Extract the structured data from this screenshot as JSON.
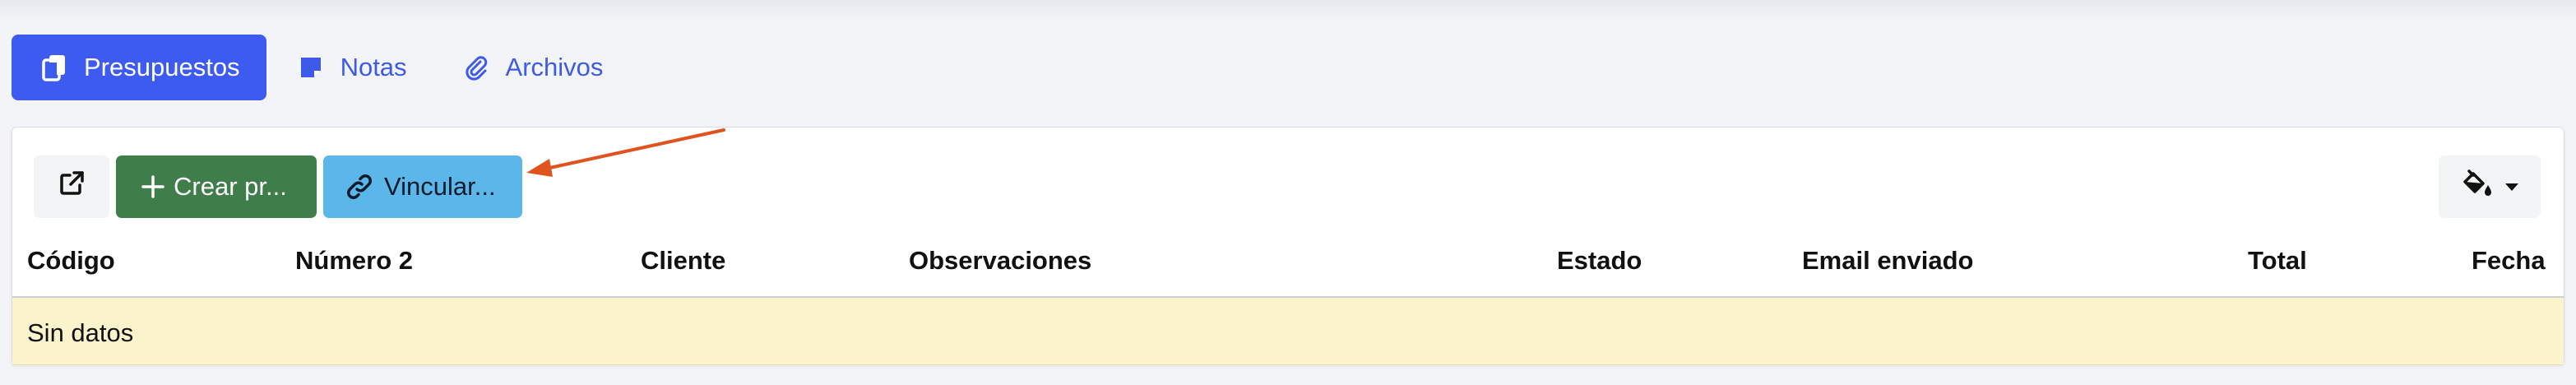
{
  "tabs": [
    {
      "label": "Presupuestos",
      "icon": "copy-icon",
      "active": true
    },
    {
      "label": "Notas",
      "icon": "sticky-note-icon",
      "active": false
    },
    {
      "label": "Archivos",
      "icon": "paperclip-icon",
      "active": false
    }
  ],
  "toolbar": {
    "open_external_icon": "external-link-icon",
    "create_label": "Crear pr...",
    "create_icon": "plus-icon",
    "link_label": "Vincular...",
    "link_icon": "link-icon",
    "paint_icon": "paint-bucket-icon",
    "paint_dropdown_icon": "caret-down-icon"
  },
  "table": {
    "columns": [
      "Código",
      "Número 2",
      "Cliente",
      "Observaciones",
      "Estado",
      "Email enviado",
      "Total",
      "Fecha"
    ],
    "empty_text": "Sin datos"
  },
  "colors": {
    "primary": "#3d5af1",
    "success": "#3f7d4b",
    "info": "#5bb6ea",
    "empty_row_bg": "#faf3cb",
    "annotation_arrow": "#e0531f"
  }
}
